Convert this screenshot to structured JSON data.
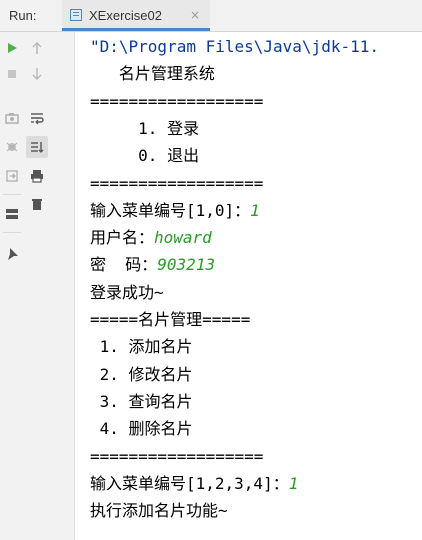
{
  "run_panel": {
    "label": "Run:",
    "tab": {
      "name": "XExercise02",
      "close": "×",
      "accent": "#4a87c4"
    }
  },
  "toolbar": {
    "column1": [
      "rerun-icon",
      "stop-icon",
      "camera-icon",
      "debug-icon",
      "exit-icon",
      "layout-icon",
      "pin-icon"
    ],
    "column2": [
      "up-arrow-icon",
      "down-arrow-icon",
      "soft-wrap-icon",
      "scroll-to-end-icon",
      "print-icon",
      "trash-icon"
    ]
  },
  "console": {
    "colors": {
      "text": "#000000",
      "path": "#0a3b9c",
      "input": "#2b9b2b"
    },
    "lines": [
      {
        "text": "\"D:\\Program Files\\Java\\jdk-11.",
        "style": "path"
      },
      {
        "text": "   名片管理系统"
      },
      {
        "text": "=================="
      },
      {
        "text": "     1. 登录"
      },
      {
        "text": "     0. 退出"
      },
      {
        "text": "=================="
      },
      {
        "text": "输入菜单编号[1,0]：",
        "input": "1"
      },
      {
        "text": "用户名：",
        "input": "howard"
      },
      {
        "text": "密  码：",
        "input": "903213"
      },
      {
        "text": "登录成功~"
      },
      {
        "text": "=====名片管理====="
      },
      {
        "text": " 1. 添加名片"
      },
      {
        "text": " 2. 修改名片"
      },
      {
        "text": " 3. 查询名片"
      },
      {
        "text": " 4. 删除名片"
      },
      {
        "text": "=================="
      },
      {
        "text": "输入菜单编号[1,2,3,4]：",
        "input": "1"
      },
      {
        "text": "执行添加名片功能~"
      }
    ]
  }
}
